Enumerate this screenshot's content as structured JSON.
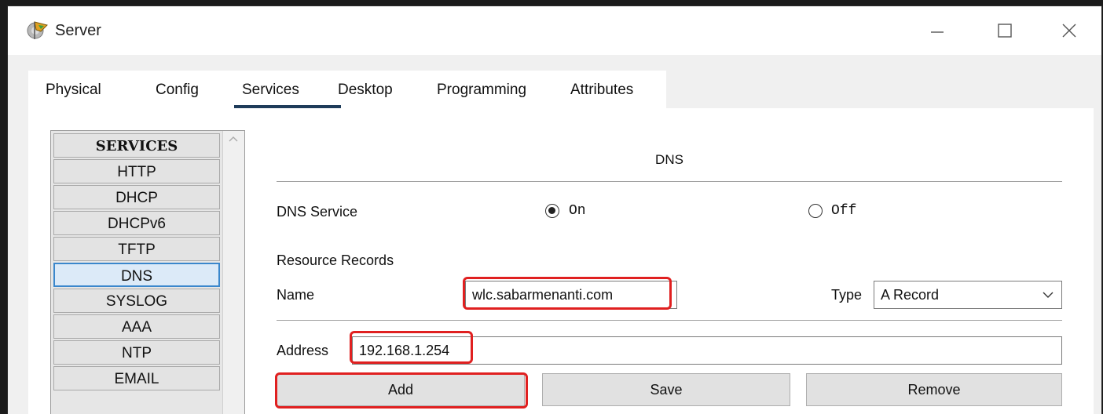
{
  "window": {
    "title": "Server",
    "icon": "packet-tracer-server-icon"
  },
  "controls": {
    "minimize_icon": "minimize-icon",
    "maximize_icon": "maximize-icon",
    "close_icon": "close-icon"
  },
  "tabs": [
    {
      "label": "Physical"
    },
    {
      "label": "Config"
    },
    {
      "label": "Services",
      "selected": true
    },
    {
      "label": "Desktop"
    },
    {
      "label": "Programming"
    },
    {
      "label": "Attributes"
    }
  ],
  "services": {
    "header": "SERVICES",
    "items": [
      "HTTP",
      "DHCP",
      "DHCPv6",
      "TFTP",
      "DNS",
      "SYSLOG",
      "AAA",
      "NTP",
      "EMAIL"
    ],
    "active": "DNS"
  },
  "dns": {
    "heading": "DNS",
    "service_label": "DNS Service",
    "on_label": "On",
    "off_label": "Off",
    "service_state": "On",
    "records_label": "Resource Records",
    "name_label": "Name",
    "name_value": "wlc.sabarmenanti.com",
    "type_label": "Type",
    "type_value": "A Record",
    "address_label": "Address",
    "address_value": "192.168.1.254",
    "add_label": "Add",
    "save_label": "Save",
    "remove_label": "Remove"
  },
  "colors": {
    "highlight": "#e02020",
    "tab_underline": "#1e3c5a",
    "active_service_border": "#3b87cc"
  }
}
